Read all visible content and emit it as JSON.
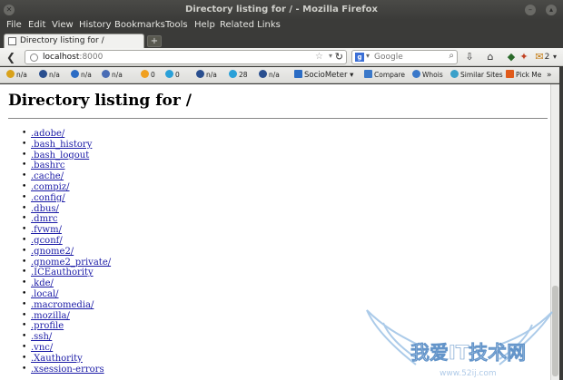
{
  "window": {
    "title": "Directory listing for / - Mozilla Firefox"
  },
  "menu": [
    "File",
    "Edit",
    "View",
    "History",
    "Bookmarks",
    "Tools",
    "Help",
    "Related Links"
  ],
  "tab": {
    "label": "Directory listing for /",
    "newtab": "+"
  },
  "url": {
    "host": "localhost",
    "port": ":8000"
  },
  "search": {
    "placeholder": "Google"
  },
  "addon_badge": "2",
  "bookmarks": [
    {
      "label": "n/a",
      "color": "#d9a21b"
    },
    {
      "label": "n/a",
      "color": "#2a4f8f"
    },
    {
      "label": "n/a",
      "color": "#2b6cc4"
    },
    {
      "label": "n/a",
      "color": "#4a6db5"
    },
    {
      "label": "0",
      "color": "#f0a020"
    },
    {
      "label": "0",
      "color": "#2aa0d8"
    },
    {
      "label": "n/a",
      "color": "#2a4f8f"
    },
    {
      "label": "28",
      "color": "#2aa0d8"
    },
    {
      "label": "n/a",
      "color": "#2a4f8f"
    },
    {
      "label": "SocioMeter",
      "color": "#2b6cc4"
    },
    {
      "label": "Compare",
      "color": "#3a78c9"
    },
    {
      "label": "Whois",
      "color": "#3a78c9"
    },
    {
      "label": "Similar Sites",
      "color": "#3aa0c9"
    },
    {
      "label": "Pick Me",
      "color": "#e05a1a"
    }
  ],
  "page": {
    "heading": "Directory listing for /",
    "entries": [
      ".adobe/",
      ".bash_history",
      ".bash_logout",
      ".bashrc",
      ".cache/",
      ".compiz/",
      ".config/",
      ".dbus/",
      ".dmrc",
      ".fvwm/",
      ".gconf/",
      ".gnome2/",
      ".gnome2_private/",
      ".ICEauthority",
      ".kde/",
      ".local/",
      ".macromedia/",
      ".mozilla/",
      ".profile",
      ".ssh/",
      ".vnc/",
      ".Xauthority",
      ".xsession-errors"
    ]
  },
  "watermark": {
    "text": "我爱IT技术网",
    "url": "www.52ij.com"
  }
}
